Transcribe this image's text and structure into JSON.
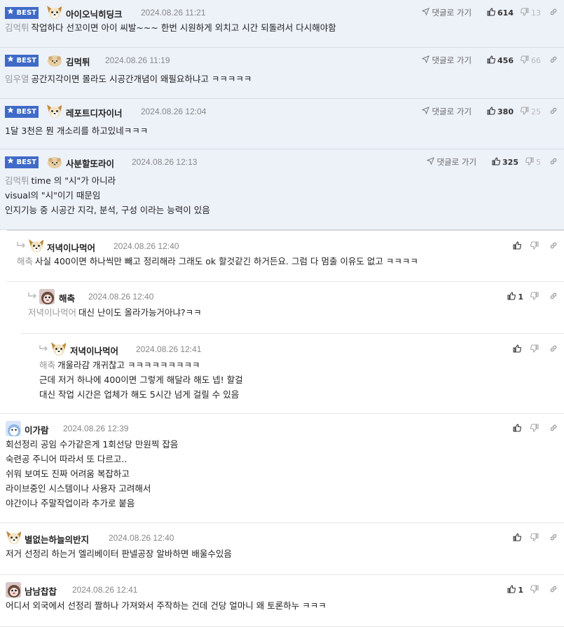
{
  "labels": {
    "best": "BEST",
    "reply_link": "댓글로 가기"
  },
  "comments": [
    {
      "best": true,
      "avatar": "dog-face-icon",
      "nick": "아이오닉히딩크",
      "time": "2024.08.26 11:21",
      "likes": "614",
      "dislikes": "13",
      "lines": [
        {
          "mention": "김먹튀",
          "text": "작업하다 선꼬이면 아이 씨발~~~ 한번 시원하게 외치고 시간 되돌려서 다시해야함"
        }
      ]
    },
    {
      "best": true,
      "avatar": "pudding-icon",
      "nick": "김먹튀",
      "time": "2024.08.26 11:19",
      "likes": "456",
      "dislikes": "66",
      "lines": [
        {
          "mention": "임우열",
          "text": "공간지각이면 몰라도 시공간개념이 왜필요하냐고 ㅋㅋㅋㅋㅋ"
        }
      ]
    },
    {
      "best": true,
      "avatar": "dog-face-icon",
      "nick": "레포트디자이너",
      "time": "2024.08.26 12:04",
      "likes": "380",
      "dislikes": "25",
      "lines": [
        {
          "mention": "",
          "text": "1달 3천은 뭔 개소리를 하고있네ㅋㅋㅋ"
        }
      ]
    },
    {
      "best": true,
      "avatar": "pudding-icon",
      "nick": "사분할또라이",
      "time": "2024.08.26 12:13",
      "likes": "325",
      "dislikes": "5",
      "lines": [
        {
          "mention": "김먹튀",
          "text": "time 의 \"시\"가 아니라"
        },
        {
          "mention": "",
          "text": "visual의 \"시\"이기 때문임"
        },
        {
          "mention": "",
          "text": "인지기능 중 시공간 지각, 분석, 구성 이라는 능력이 있음"
        }
      ]
    },
    {
      "depth": 1,
      "avatar": "dog-face-icon",
      "nick": "저녁이나먹어",
      "time": "2024.08.26 12:40",
      "likes": "",
      "dislikes": "",
      "lines": [
        {
          "mention": "해축",
          "text": "사실 400이면 하나씩만 빼고 정리해라 그래도 ok 할것같긴 하거든요. 그럼 다 멈출 이유도 없고 ㅋㅋㅋㅋ"
        }
      ]
    },
    {
      "depth": 2,
      "avatar": "monkey-icon",
      "nick": "해축",
      "time": "2024.08.26 12:40",
      "likes": "1",
      "dislikes": "",
      "lines": [
        {
          "mention": "저녁이나먹어",
          "text": "대신 난이도 올라가능거아냐?ㅋㅋ"
        }
      ]
    },
    {
      "depth": 3,
      "avatar": "dog-face-icon",
      "nick": "저녁이나먹어",
      "time": "2024.08.26 12:41",
      "likes": "",
      "dislikes": "",
      "lines": [
        {
          "mention": "해축",
          "text": "개울라감 개귀찮고 ㅋㅋㅋㅋㅋㅋㅋㅋㅋ"
        },
        {
          "mention": "",
          "text": "근데 저거 하나에 400이면 그렇게 해달라 해도 넵! 할걸"
        },
        {
          "mention": "",
          "text": "대신 작업 시간은 업체가 해도 5시간 넘게 걸릴 수 있음"
        }
      ]
    },
    {
      "depth": 0,
      "avatar": "blue-character-icon",
      "nick": "이가람",
      "time": "2024.08.26 12:39",
      "likes": "",
      "dislikes": "",
      "lines": [
        {
          "mention": "",
          "text": "회선정리 공임 수가같은게 1회선당 만원찍 잡음"
        },
        {
          "mention": "",
          "text": "숙련공 주니어 따라서 또 다르고.."
        },
        {
          "mention": "",
          "text": "쉬워 보여도 진짜 어려움 복잡하고"
        },
        {
          "mention": "",
          "text": "라이브중인 시스템이나 사용자 고려해서"
        },
        {
          "mention": "",
          "text": "야간이나 주말작업이라 추가로 붙음"
        }
      ]
    },
    {
      "depth": 0,
      "avatar": "dog-face-icon",
      "nick": "별없는하늘의반지",
      "time": "2024.08.26 12:40",
      "likes": "",
      "dislikes": "",
      "lines": [
        {
          "mention": "",
          "text": "저거 선정리 하는거 엘리베이터 판넬공장 알바하면 배울수있음"
        }
      ]
    },
    {
      "depth": 0,
      "avatar": "monkey-icon",
      "nick": "남남찹찹",
      "time": "2024.08.26 12:41",
      "likes": "1",
      "dislikes": "",
      "lines": [
        {
          "mention": "",
          "text": "어디서 외국에서 선정리 짤하나 가져와서 주작하는 건데 건당 얼마니 왜 토론하누 ㅋㅋㅋ"
        }
      ]
    }
  ],
  "colors": {
    "best_bg": "#edf1f8",
    "badge": "#3f6ac8",
    "mention": "#999999"
  }
}
